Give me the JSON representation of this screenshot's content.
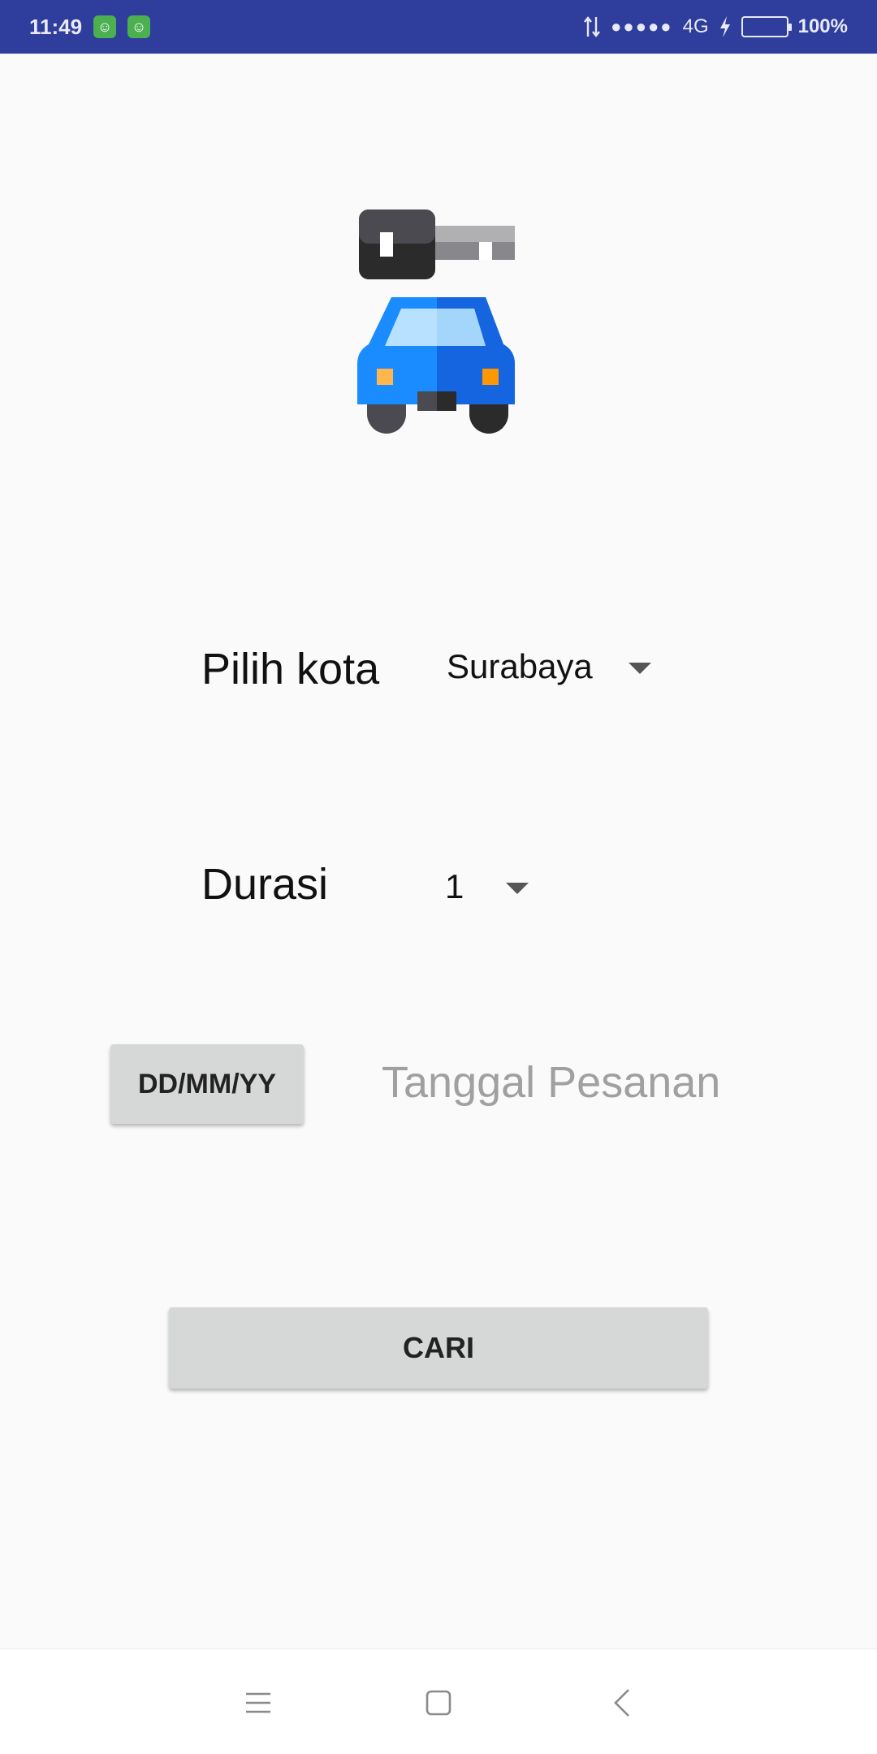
{
  "status_bar": {
    "time": "11:49",
    "network": "4G",
    "signal": "●●●●●",
    "battery_percent": "100%",
    "battery_level": 1.0,
    "notification_icons": [
      "android-notification-icon",
      "android-notification-icon"
    ]
  },
  "logo": {
    "icon": "car-key-icon",
    "colors": {
      "car": "#1e88e5",
      "key": "#424242"
    }
  },
  "form": {
    "city": {
      "label": "Pilih kota",
      "selected": "Surabaya"
    },
    "duration": {
      "label": "Durasi",
      "selected": "1"
    },
    "date": {
      "button_label": "DD/MM/YY",
      "hint": "Tanggal Pesanan"
    },
    "search_button": "CARI"
  },
  "nav_bar": {
    "items": [
      "menu-icon",
      "home-icon",
      "back-icon"
    ]
  }
}
